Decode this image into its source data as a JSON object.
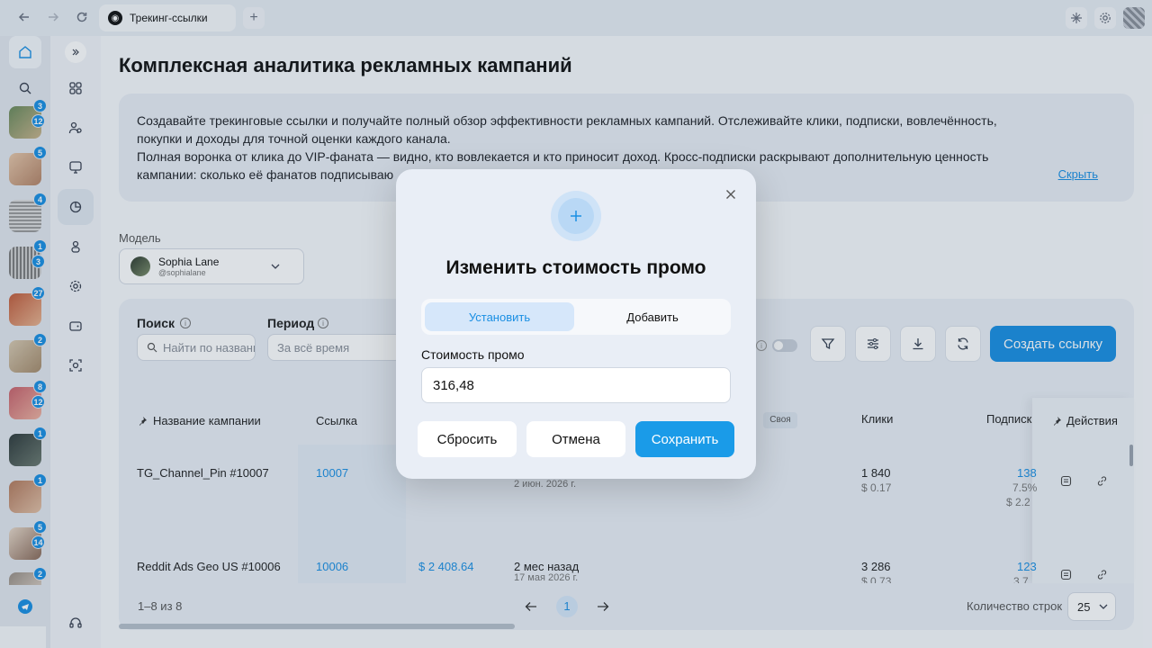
{
  "browser": {
    "tab_title": "Трекинг-ссылки",
    "new_tab": "+"
  },
  "dock": {
    "badges": [
      {
        "a": "3",
        "b": "12"
      },
      {
        "a": "5"
      },
      {
        "a": "4"
      },
      {
        "a": "1",
        "b": "3"
      },
      {
        "a": "27"
      },
      {
        "a": "2"
      },
      {
        "a": "8",
        "b": "12"
      },
      {
        "a": "1"
      },
      {
        "a": "1"
      },
      {
        "a": "5",
        "b": "14"
      },
      {
        "a": "2"
      }
    ]
  },
  "page": {
    "title": "Комплексная аналитика рекламных кампаний",
    "info_lines": [
      "Создавайте трекинговые ссылки и получайте полный обзор эффективности рекламных кампаний. Отслеживайте клики, подписки, вовлечённость,",
      "покупки и доходы для точной оценки каждого канала.",
      "Полная воронка от клика до VIP-фаната — видно, кто вовлекается и кто приносит доход. Кросс-подписки раскрывают дополнительную ценность",
      "кампании: сколько её фанатов подписываю"
    ],
    "hide_link": "Скрыть",
    "model_label": "Модель",
    "model_name": "Sophia Lane",
    "model_handle": "@sophialane"
  },
  "filters": {
    "search_label": "Поиск",
    "search_placeholder": "Найти по названи",
    "period_label": "Период",
    "period_placeholder": "За всё время",
    "create_button": "Создать ссылку"
  },
  "table": {
    "headers": {
      "name": "Название кампании",
      "link": "Ссылка",
      "own": "Своя",
      "clicks": "Клики",
      "subs": "Подписки",
      "actions": "Действия"
    },
    "rows": [
      {
        "name": "TG_Channel_Pin #10007",
        "link": "10007",
        "cost": "",
        "date": "",
        "date_sub": "2 июн. 2026 г.",
        "clicks": "1 840",
        "clicks_sub": "$ 0.17",
        "subs": "138",
        "subs_sub1": "7.5%",
        "subs_sub2": "$ 2.2"
      },
      {
        "name": "Reddit Ads Geo US #10006",
        "link": "10006",
        "cost": "$ 2 408.64",
        "date": "2 мес назад",
        "date_sub": "17 мая 2026 г.",
        "clicks": "3 286",
        "clicks_sub": "$ 0.73",
        "subs": "123",
        "subs_sub1": "3.7",
        "subs_sub2": ""
      }
    ]
  },
  "pagination": {
    "range": "1–8 из 8",
    "page": "1",
    "rows_label": "Количество строк",
    "rows_value": "25"
  },
  "modal": {
    "title": "Изменить стоимость промо",
    "tab_set": "Установить",
    "tab_add": "Добавить",
    "field_label": "Стоимость промо",
    "field_value": "316,48",
    "reset": "Сбросить",
    "cancel": "Отмена",
    "save": "Сохранить"
  },
  "colors": {
    "accent": "#1a8fe3",
    "background": "#f7f9fc"
  }
}
